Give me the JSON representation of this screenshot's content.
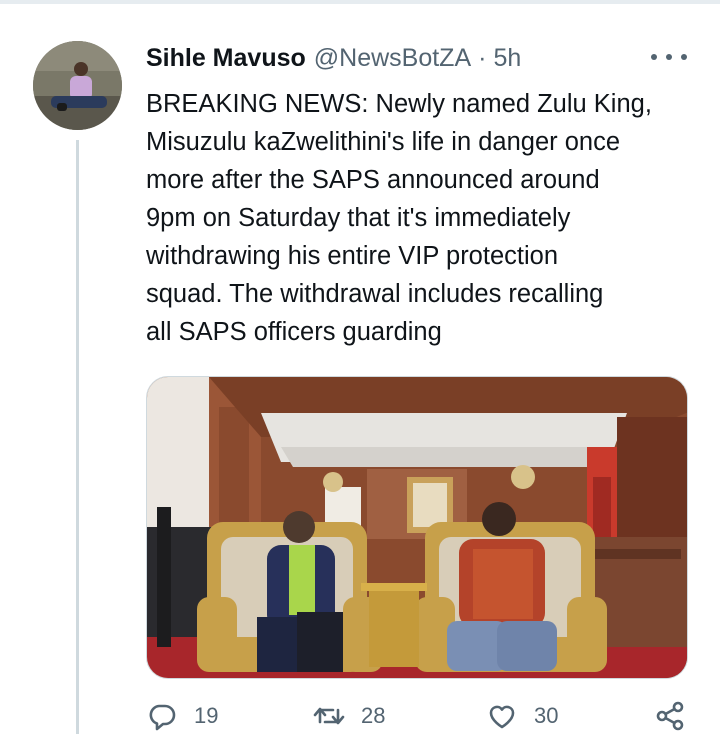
{
  "tweet": {
    "author_name": "Sihle Mavuso",
    "handle": "@NewsBotZA",
    "separator": "·",
    "time": "5h",
    "text": "BREAKING NEWS: Newly named Zulu King,\nMisuzulu kaZwelithini's life in danger once\nmore after the SAPS announced around\n9pm on Saturday that it's immediately\nwithdrawing his entire VIP protection\nsquad. The withdrawal includes recalling\nall SAPS officers guarding"
  },
  "actions": {
    "replies": "19",
    "retweets": "28",
    "likes": "30"
  },
  "icons": {
    "more": "more-dots-icon",
    "reply": "reply-icon",
    "retweet": "retweet-icon",
    "like": "heart-icon",
    "share": "share-icon"
  },
  "colors": {
    "text": "#0f1419",
    "secondary": "#536471",
    "divider": "#cfd9de"
  }
}
